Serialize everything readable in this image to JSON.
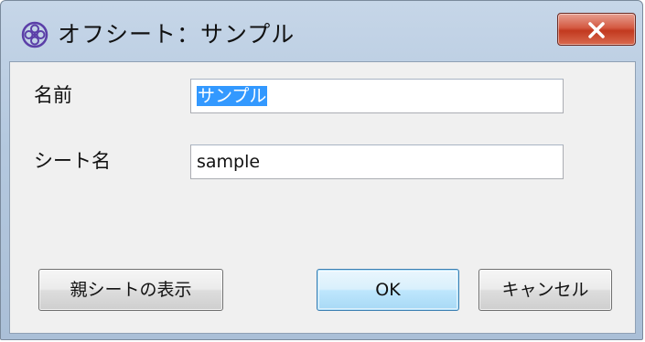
{
  "window": {
    "title": "オフシート：サンプル",
    "icon": "sheet-flower-icon",
    "close_icon": "close-x-icon"
  },
  "form": {
    "name_label": "名前",
    "name_value": "サンプル",
    "sheet_name_label": "シート名",
    "sheet_name_value": "sample"
  },
  "buttons": {
    "show_parent_label": "親シートの表示",
    "ok_label": "OK",
    "cancel_label": "キャンセル"
  },
  "colors": {
    "title_bar": "#b5c9df",
    "close_button": "#c2391f",
    "selection": "#3399ff",
    "default_button_border": "#3c7fb1"
  }
}
